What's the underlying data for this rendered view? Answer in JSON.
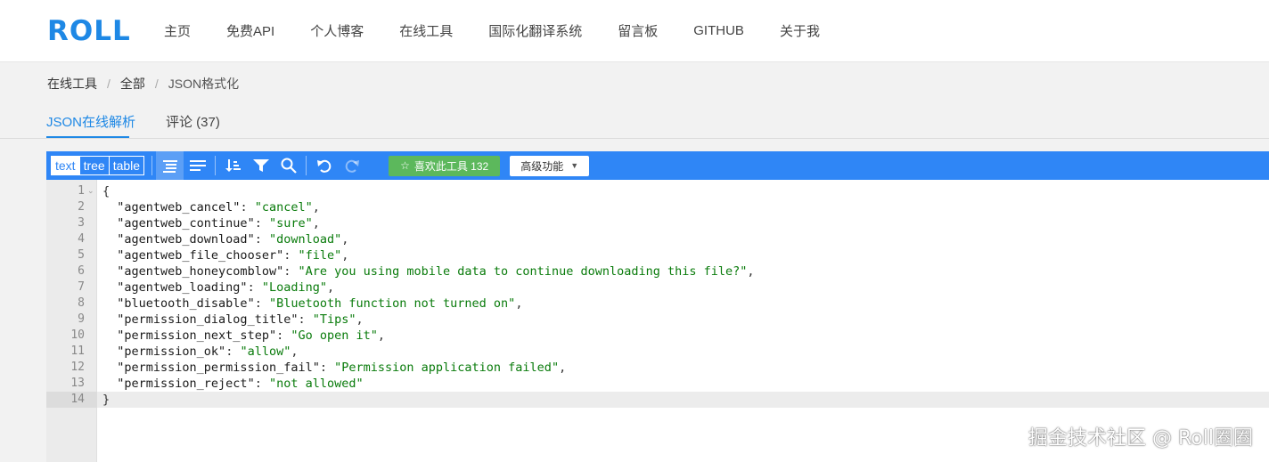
{
  "header": {
    "logo": "ROLL",
    "nav": [
      "主页",
      "免费API",
      "个人博客",
      "在线工具",
      "国际化翻译系统",
      "留言板",
      "GITHUB",
      "关于我"
    ]
  },
  "breadcrumb": {
    "items": [
      "在线工具",
      "全部"
    ],
    "current": "JSON格式化",
    "separator": "/"
  },
  "tabs": {
    "active": "JSON在线解析",
    "comments": "评论 (37)"
  },
  "toolbar": {
    "modes": [
      "text",
      "tree",
      "table"
    ],
    "active_mode": "text",
    "like_label": "喜欢此工具 132",
    "advanced_label": "高级功能",
    "icons": [
      "format-icon",
      "compact-icon",
      "sort-icon",
      "filter-icon",
      "search-icon",
      "undo-icon",
      "redo-icon"
    ],
    "accent_color": "#2f86f6",
    "like_color": "#5cb85c"
  },
  "editor": {
    "line_numbers": [
      "1",
      "2",
      "3",
      "4",
      "5",
      "6",
      "7",
      "8",
      "9",
      "10",
      "11",
      "12",
      "13",
      "14"
    ],
    "open_brace": "{",
    "close_brace": "}",
    "entries": [
      {
        "key": "\"agentweb_cancel\"",
        "value": "\"cancel\""
      },
      {
        "key": "\"agentweb_continue\"",
        "value": "\"sure\""
      },
      {
        "key": "\"agentweb_download\"",
        "value": "\"download\""
      },
      {
        "key": "\"agentweb_file_chooser\"",
        "value": "\"file\""
      },
      {
        "key": "\"agentweb_honeycomblow\"",
        "value": "\"Are you using mobile data to continue downloading this file?\""
      },
      {
        "key": "\"agentweb_loading\"",
        "value": "\"Loading\""
      },
      {
        "key": "\"bluetooth_disable\"",
        "value": "\"Bluetooth function not turned on\""
      },
      {
        "key": "\"permission_dialog_title\"",
        "value": "\"Tips\""
      },
      {
        "key": "\"permission_next_step\"",
        "value": "\"Go open it\""
      },
      {
        "key": "\"permission_ok\"",
        "value": "\"allow\""
      },
      {
        "key": "\"permission_permission_fail\"",
        "value": "\"Permission application failed\""
      },
      {
        "key": "\"permission_reject\"",
        "value": "\"not allowed\""
      }
    ],
    "key_color": "#1a1a1a",
    "string_color": "#097b0b"
  },
  "watermark": "掘金技术社区 @ Roll圈圈"
}
